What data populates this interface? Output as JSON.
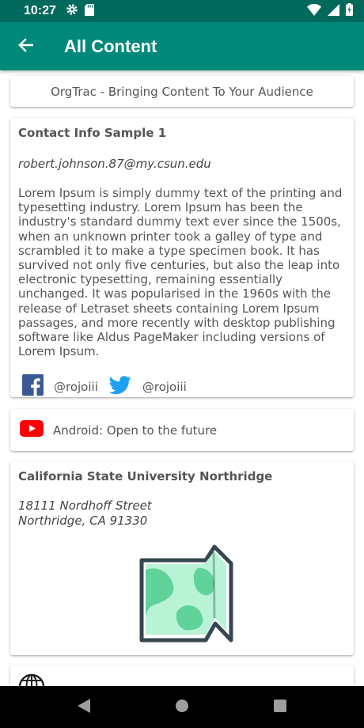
{
  "status_bar": {
    "time": "10:27",
    "icons": [
      "gear-icon",
      "sd-card-icon",
      "wifi-icon",
      "signal-icon",
      "battery-charging-icon"
    ]
  },
  "app_bar": {
    "title": "All Content",
    "back_icon": "arrow-back-icon",
    "background": "#00897b",
    "status_background": "#00695c"
  },
  "header_card": {
    "text": "OrgTrac - Bringing Content To Your Audience"
  },
  "contact_card": {
    "title": "Contact Info Sample 1",
    "email": "robert.johnson.87@my.csun.edu",
    "body": "Lorem Ipsum is simply dummy text of the printing and typesetting industry. Lorem Ipsum has been the industry's standard dummy text ever since the 1500s, when an unknown printer took a galley of type and scrambled it to make a type specimen book. It has survived not only five centuries, but also the leap into electronic typesetting, remaining essentially unchanged. It was popularised in the 1960s with the release of Letraset sheets containing Lorem Ipsum passages, and more recently with desktop publishing software like Aldus PageMaker including versions of Lorem Ipsum.",
    "facebook_handle": "@rojoiii",
    "twitter_handle": "@rojoiii",
    "facebook_color": "#3b5998",
    "twitter_color": "#1da1f2"
  },
  "video_card": {
    "title": "Android: Open to the future",
    "icon": "youtube-icon",
    "icon_color": "#ff0000"
  },
  "address_card": {
    "title": "California State University Northridge",
    "address_line1": "18111 Nordhoff Street",
    "address_line2": "Northridge, CA 91330",
    "icon": "map-icon",
    "map_color": "#5fd39a"
  },
  "web_card": {
    "icon": "globe-icon"
  },
  "nav_bar": {
    "buttons": [
      "back-triangle-icon",
      "home-circle-icon",
      "recents-square-icon"
    ]
  }
}
